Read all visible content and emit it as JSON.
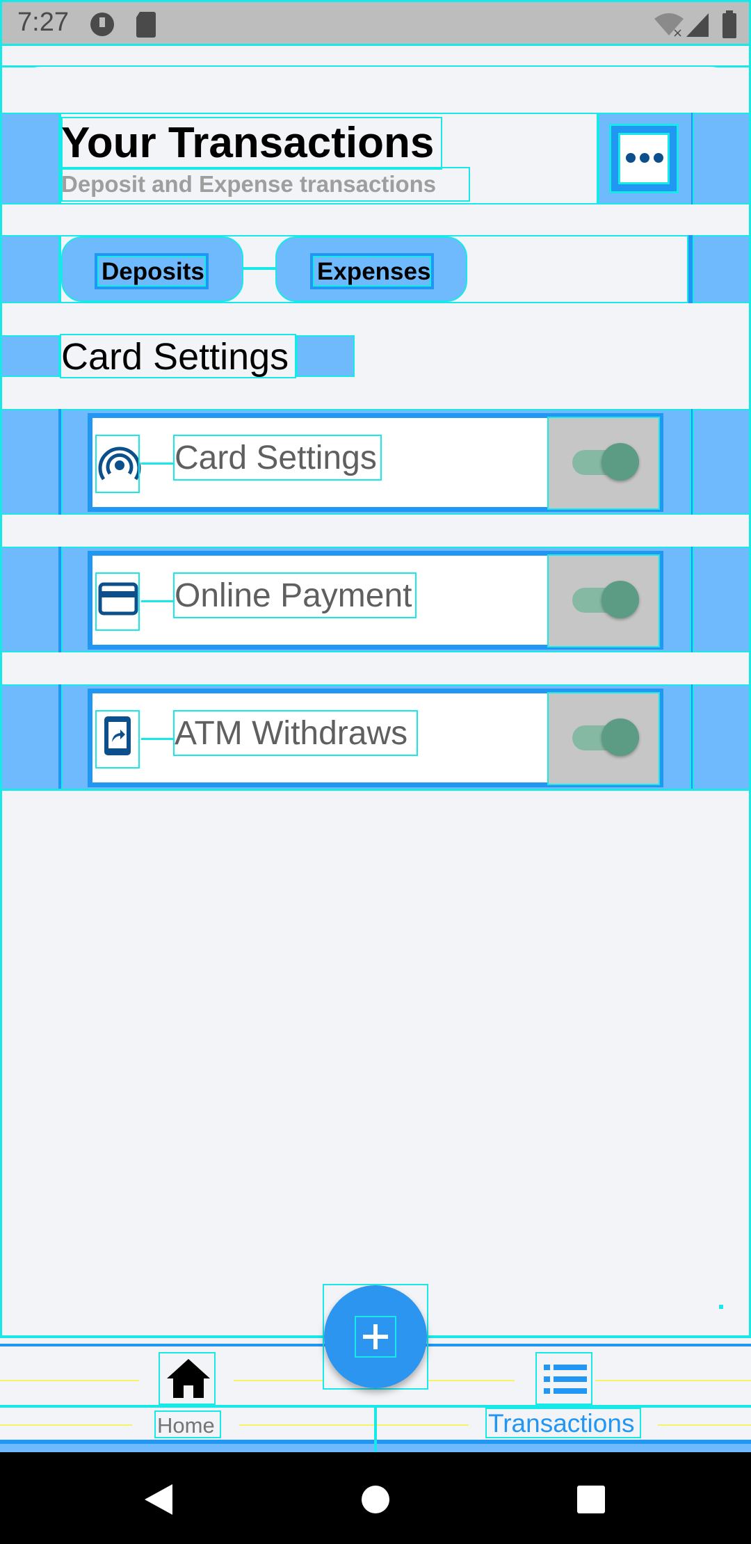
{
  "status_bar": {
    "time": "7:27"
  },
  "header": {
    "title": "Your Transactions",
    "subtitle": "Deposit and Expense transactions",
    "menu_icon": "more-horizontal-icon"
  },
  "tabs": [
    {
      "label": "Deposits"
    },
    {
      "label": "Expenses"
    }
  ],
  "section_title": "Card Settings",
  "settings": [
    {
      "label": "Card Settings",
      "icon": "contactless-icon",
      "enabled": true
    },
    {
      "label": "Online Payment",
      "icon": "credit-card-icon",
      "enabled": true
    },
    {
      "label": "ATM Withdraws",
      "icon": "mobile-share-icon",
      "enabled": true
    }
  ],
  "bottom_nav": {
    "items": [
      {
        "label": "Home",
        "icon": "home-icon"
      },
      {
        "label": "Transactions",
        "icon": "list-icon"
      }
    ],
    "fab_icon": "plus-icon"
  },
  "colors": {
    "accent": "#2196f3",
    "highlight": "#6fbafc",
    "outline": "#18e8e8",
    "toggle_track": "#86b9a3",
    "toggle_thumb": "#5d9c84"
  }
}
